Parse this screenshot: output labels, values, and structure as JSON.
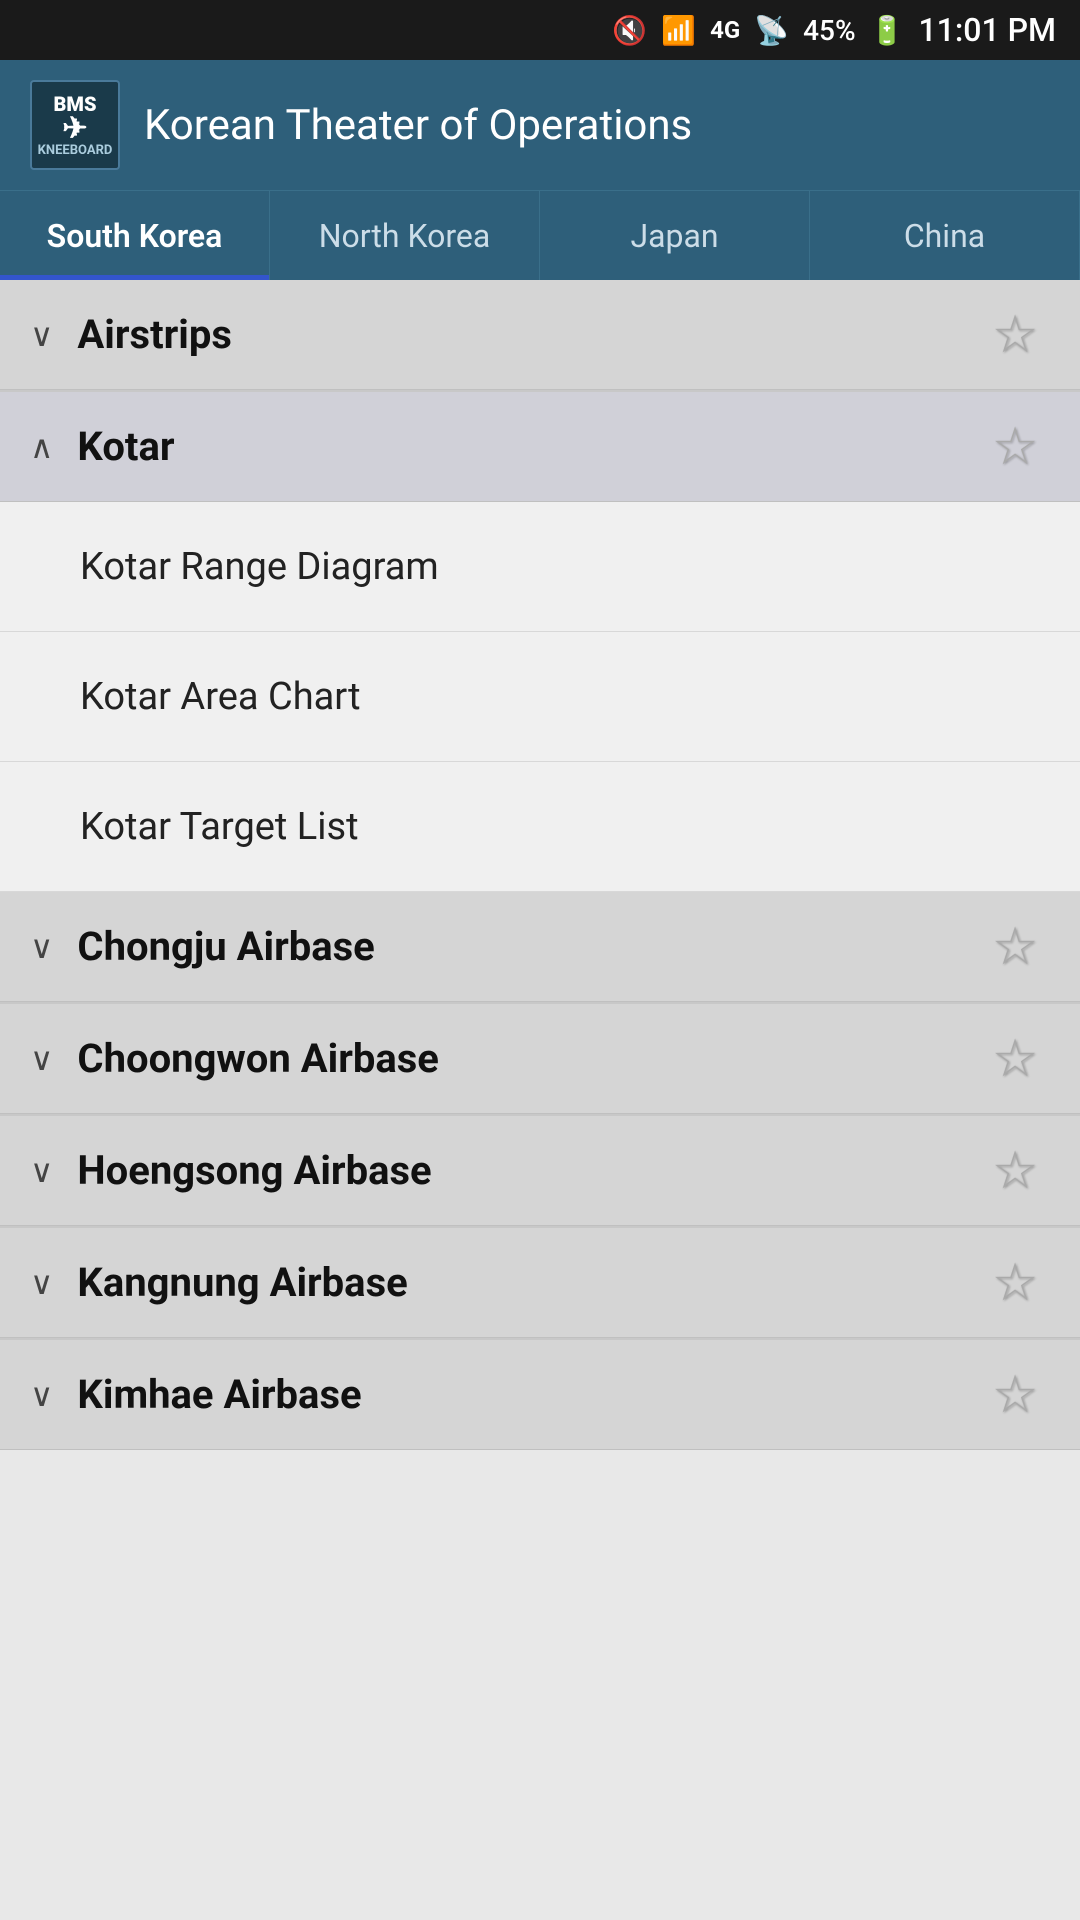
{
  "statusBar": {
    "time": "11:01 PM",
    "battery": "45%",
    "icons": [
      "mute",
      "wifi",
      "lte",
      "signal"
    ]
  },
  "header": {
    "logoTop": "BMS",
    "logoBottom": "KNEEBOARD",
    "title": "Korean Theater of Operations"
  },
  "tabs": [
    {
      "id": "south-korea",
      "label": "South Korea",
      "active": true
    },
    {
      "id": "north-korea",
      "label": "North Korea",
      "active": false
    },
    {
      "id": "japan",
      "label": "Japan",
      "active": false
    },
    {
      "id": "china",
      "label": "China",
      "active": false
    }
  ],
  "sections": [
    {
      "id": "airstrips",
      "title": "Airstrips",
      "expanded": false,
      "chevron": "down",
      "subitems": []
    },
    {
      "id": "kotar",
      "title": "Kotar",
      "expanded": true,
      "chevron": "up",
      "subitems": [
        {
          "label": "Kotar Range Diagram"
        },
        {
          "label": "Kotar Area Chart"
        },
        {
          "label": "Kotar Target List"
        }
      ]
    },
    {
      "id": "chongju",
      "title": "Chongju Airbase",
      "expanded": false,
      "chevron": "down",
      "subitems": []
    },
    {
      "id": "choongwon",
      "title": "Choongwon Airbase",
      "expanded": false,
      "chevron": "down",
      "subitems": []
    },
    {
      "id": "hoengsong",
      "title": "Hoengsong Airbase",
      "expanded": false,
      "chevron": "down",
      "subitems": []
    },
    {
      "id": "kangnung",
      "title": "Kangnung Airbase",
      "expanded": false,
      "chevron": "down",
      "subitems": []
    },
    {
      "id": "kimhae",
      "title": "Kimhae Airbase",
      "expanded": false,
      "chevron": "down",
      "subitems": []
    }
  ]
}
